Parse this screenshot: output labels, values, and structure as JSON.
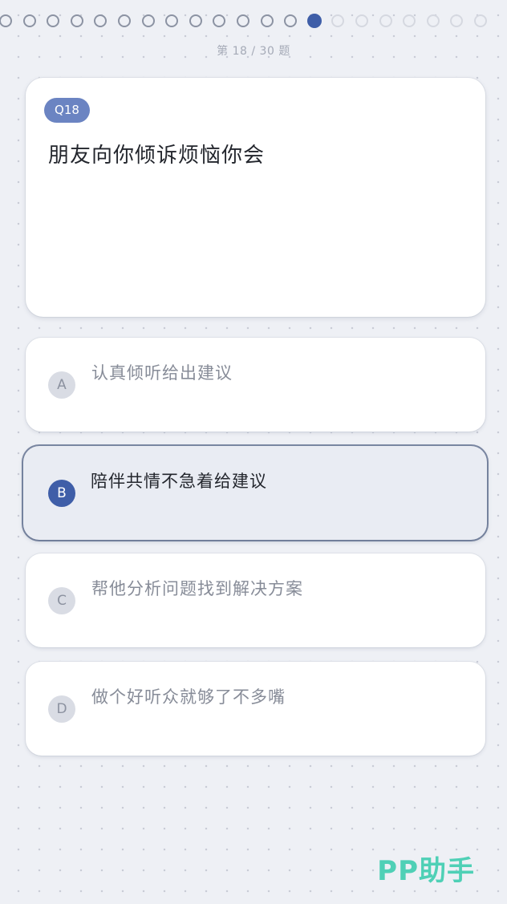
{
  "progress": {
    "done_count": 13,
    "current_index": 13,
    "todo_count": 8,
    "label": "第 18 / 30 题",
    "colors": {
      "done": "#8c93a3",
      "current": "#3f5ea8",
      "todo": "#d5d8e0"
    }
  },
  "question": {
    "badge": "Q18",
    "text": "朋友向你倾诉烦恼你会"
  },
  "options": [
    {
      "letter": "A",
      "text": "认真倾听给出建议",
      "selected": false
    },
    {
      "letter": "B",
      "text": "陪伴共情不急着给建议",
      "selected": true
    },
    {
      "letter": "C",
      "text": "帮他分析问题找到解决方案",
      "selected": false
    },
    {
      "letter": "D",
      "text": "做个好听众就够了不多嘴",
      "selected": false
    }
  ],
  "watermark": "PP助手",
  "theme": {
    "accent": "#3f5ea8",
    "badge": "#6b84c2",
    "watermark": "#4fd0b6"
  }
}
